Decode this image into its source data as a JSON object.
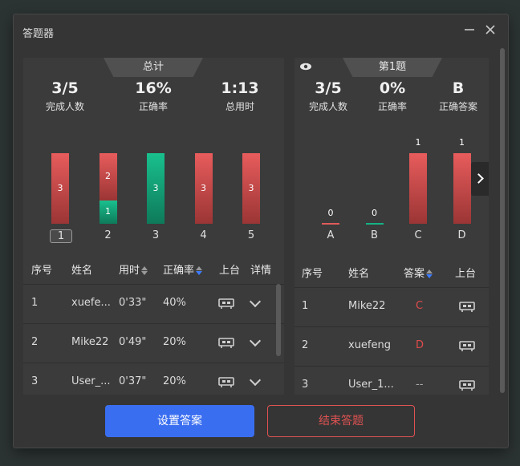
{
  "window": {
    "title": "答题器",
    "minimize_label": "–",
    "close_label": "×"
  },
  "summary": {
    "tab_label": "总计",
    "stats": [
      {
        "value": "3/5",
        "label": "完成人数"
      },
      {
        "value": "16%",
        "label": "正确率"
      },
      {
        "value": "1:13",
        "label": "总用时"
      }
    ],
    "chart_data": {
      "type": "bar",
      "categories": [
        "1",
        "2",
        "3",
        "4",
        "5"
      ],
      "series": [
        {
          "values": [
            3,
            2,
            0,
            3,
            3
          ],
          "color": "#e05a5a"
        },
        {
          "values": [
            0,
            1,
            3,
            0,
            0
          ],
          "color": "#14b384"
        }
      ],
      "selected_category": "1"
    },
    "table": {
      "headers": {
        "index": "序号",
        "name": "姓名",
        "time": "用时",
        "accuracy": "正确率",
        "stage": "上台",
        "detail": "详情"
      },
      "rows": [
        {
          "index": "1",
          "name": "xuefe...",
          "time": "0'33\"",
          "accuracy": "40%"
        },
        {
          "index": "2",
          "name": "Mike22",
          "time": "0'49\"",
          "accuracy": "20%"
        },
        {
          "index": "3",
          "name": "User_...",
          "time": "0'37\"",
          "accuracy": "20%"
        }
      ]
    }
  },
  "question": {
    "tab_label": "第1题",
    "stats": [
      {
        "value": "3/5",
        "label": "完成人数"
      },
      {
        "value": "0%",
        "label": "正确率"
      },
      {
        "value": "B",
        "label": "正确答案"
      }
    ],
    "chart_data": {
      "type": "bar",
      "categories": [
        "A",
        "B",
        "C",
        "D"
      ],
      "values": [
        0,
        0,
        1,
        1
      ],
      "colors": [
        "#e05a5a",
        "#14b384",
        "#e05a5a",
        "#e05a5a"
      ]
    },
    "table": {
      "headers": {
        "index": "序号",
        "name": "姓名",
        "answer": "答案",
        "stage": "上台"
      },
      "rows": [
        {
          "index": "1",
          "name": "Mike22",
          "answer": "C",
          "answer_color": "#e04a4a"
        },
        {
          "index": "2",
          "name": "xuefeng",
          "answer": "D",
          "answer_color": "#e04a4a"
        },
        {
          "index": "3",
          "name": "User_1...",
          "answer": "--",
          "answer_color": "#aaaaaa"
        }
      ]
    }
  },
  "buttons": {
    "set_answer": "设置答案",
    "end_quiz": "结束答题"
  }
}
